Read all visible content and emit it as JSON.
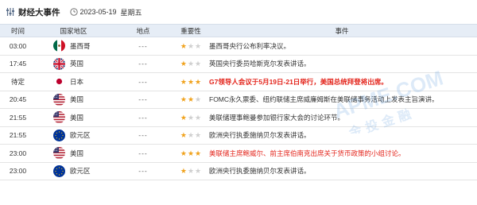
{
  "header": {
    "title": "财经大事件",
    "date": "2023-05-19",
    "weekday": "星期五"
  },
  "columns": [
    "时间",
    "国家地区",
    "地点",
    "重要性",
    "事件"
  ],
  "rows": [
    {
      "time": "03:00",
      "flag": "mexico-flag-icon",
      "region": "墨西哥",
      "place": "---",
      "importance": 1,
      "event": "墨西哥央行公布利率决议。",
      "style": "normal"
    },
    {
      "time": "17:45",
      "flag": "uk-flag-icon",
      "region": "英国",
      "place": "---",
      "importance": 1,
      "event": "英国央行委员哈斯克尔发表讲话。",
      "style": "normal"
    },
    {
      "time": "待定",
      "flag": "japan-flag-icon",
      "region": "日本",
      "place": "---",
      "importance": 3,
      "event": "G7领导人会议于5月19日-21日举行，美国总统拜登将出席。",
      "style": "highlight"
    },
    {
      "time": "20:45",
      "flag": "us-flag-icon",
      "region": "美国",
      "place": "---",
      "importance": 2,
      "event": "FOMC永久票委、纽约联储主席威廉姆斯在美联储事务活动上发表主旨演讲。",
      "style": "normal"
    },
    {
      "time": "21:55",
      "flag": "us-flag-icon",
      "region": "美国",
      "place": "---",
      "importance": 1,
      "event": "美联储理事鲍曼参加银行家大会的讨论环节。",
      "style": "normal"
    },
    {
      "time": "21:55",
      "flag": "eu-flag-icon",
      "region": "欧元区",
      "place": "---",
      "importance": 1,
      "event": "欧洲央行执委施纳贝尔发表讲话。",
      "style": "normal"
    },
    {
      "time": "23:00",
      "flag": "us-flag-icon",
      "region": "美国",
      "place": "---",
      "importance": 3,
      "event": "美联储主席鲍威尔、前主席伯南克出席关于货币政策的小组讨论。",
      "style": "red"
    },
    {
      "time": "23:00",
      "flag": "eu-flag-icon",
      "region": "欧元区",
      "place": "---",
      "importance": 1,
      "event": "欧洲央行执委施纳贝尔发表讲话。",
      "style": "normal"
    }
  ],
  "colors": {
    "accent_red": "#e3231a",
    "star_on": "#f0a21c",
    "star_off": "#cfcfcf",
    "header_bg": "#e6edf6"
  }
}
